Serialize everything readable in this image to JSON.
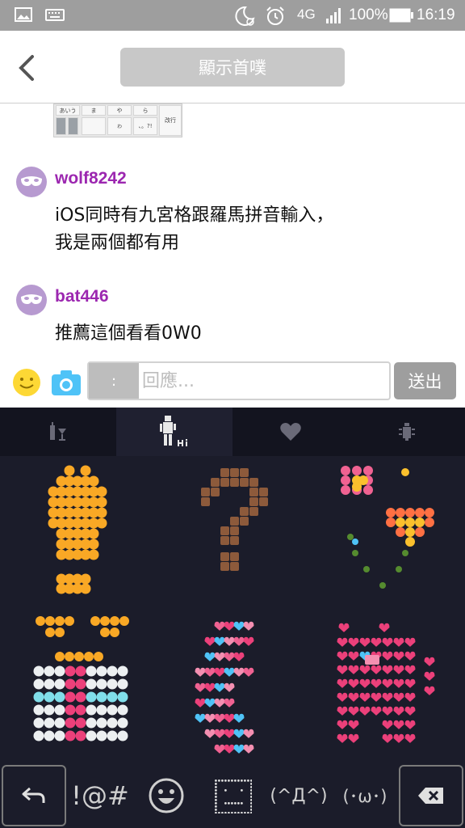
{
  "status_bar": {
    "signal_label": "4G",
    "battery": "100%",
    "time": "16:19",
    "icons": [
      "image-icon",
      "keyboard-icon",
      "moon-alarm-icon",
      "alarm-icon",
      "signal-icon",
      "battery-icon"
    ]
  },
  "header": {
    "title": "顯示首噗",
    "back_icon": "chevron-left-icon"
  },
  "chat": {
    "keyboard_preview": {
      "keys": [
        "あいう",
        "ま",
        "や",
        "ら",
        "改行",
        "",
        "",
        "ゎ",
        "、。?!"
      ]
    },
    "messages": [
      {
        "username": "wolf8242",
        "line1": "iOS同時有九宮格跟羅馬拼音輸入，",
        "line2": "我是兩個都有用"
      },
      {
        "username": "bat446",
        "line1": "推薦這個看看0W0",
        "line2": ""
      }
    ]
  },
  "composer": {
    "prefix": ":",
    "placeholder": "回應...",
    "value": "",
    "send_label": "送出"
  },
  "emoji_keyboard": {
    "tabs": [
      "drink-icon",
      "robot-hi-icon",
      "heart-icon",
      "bug-icon"
    ],
    "active_tab": 1,
    "art_items": [
      "smiley-lightbulb-art",
      "bear-question-art",
      "flower-heart-art",
      "bow-gift-art",
      "heart-cat-art",
      "heart-pig-art"
    ],
    "bottom_keys": {
      "back_icon": "return-icon",
      "symbols": "!@#",
      "emoji_icon": "smiley-face-icon",
      "dot_face_icon": "dot-matrix-face-icon",
      "kaomoji1": "(^Д^)",
      "kaomoji2": "(･ω･)",
      "delete_icon": "backspace-icon"
    }
  },
  "colors": {
    "status_bar": "#9e9e9e",
    "username": "#9c27b0",
    "avatar": "#b79ad0",
    "keyboard_bg": "#1b1c2a",
    "send_button": "#9e9e9e"
  }
}
